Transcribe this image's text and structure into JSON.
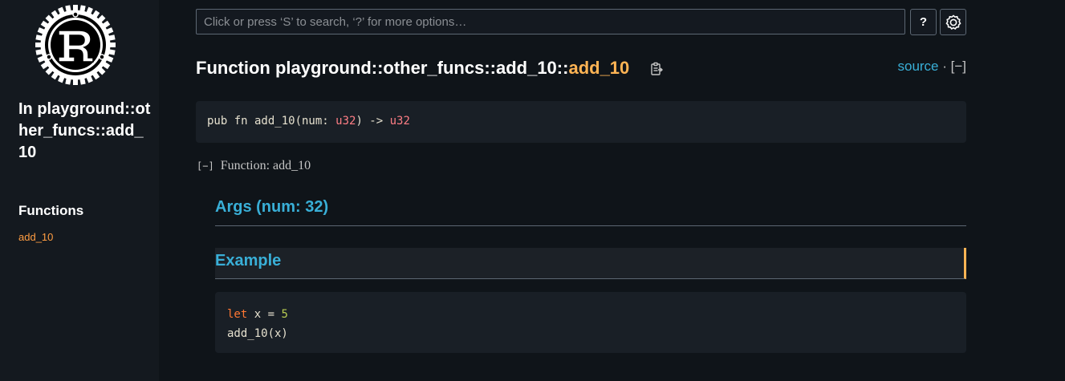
{
  "sidebar": {
    "location_title": "In playground::other_funcs::add_10",
    "section_heading": "Functions",
    "items": [
      {
        "label": "add_10"
      }
    ]
  },
  "search": {
    "placeholder": "Click or press ‘S’ to search, ‘?’ for more options…",
    "value": ""
  },
  "toolbar": {
    "help_label": "?"
  },
  "page": {
    "title_prefix": "Function playground::other_funcs::add_10::",
    "title_name": "add_10",
    "source_label": "source",
    "source_separator": " · ",
    "collapse_label": "[−]"
  },
  "signature": {
    "part1": "pub fn add_10(num: ",
    "type1": "u32",
    "part2": ") -> ",
    "type2": "u32"
  },
  "attr_toggle": {
    "toggle_label": "[−]",
    "text": "Function: add_10"
  },
  "docs": {
    "args_heading": "Args (num: 32)",
    "example_heading": "Example",
    "example_code": {
      "line1_kw": "let",
      "line1_mid": " x = ",
      "line1_num": "5",
      "line2": "add_10(x)"
    }
  },
  "colors": {
    "background": "#0f1419",
    "sidebar": "#14191f",
    "accent_function": "#ffb454",
    "link": "#39afd7",
    "sidebar_link": "#ff9d42",
    "type": "#ff7e85",
    "keyword": "#ff7733",
    "number": "#b8cc52"
  }
}
